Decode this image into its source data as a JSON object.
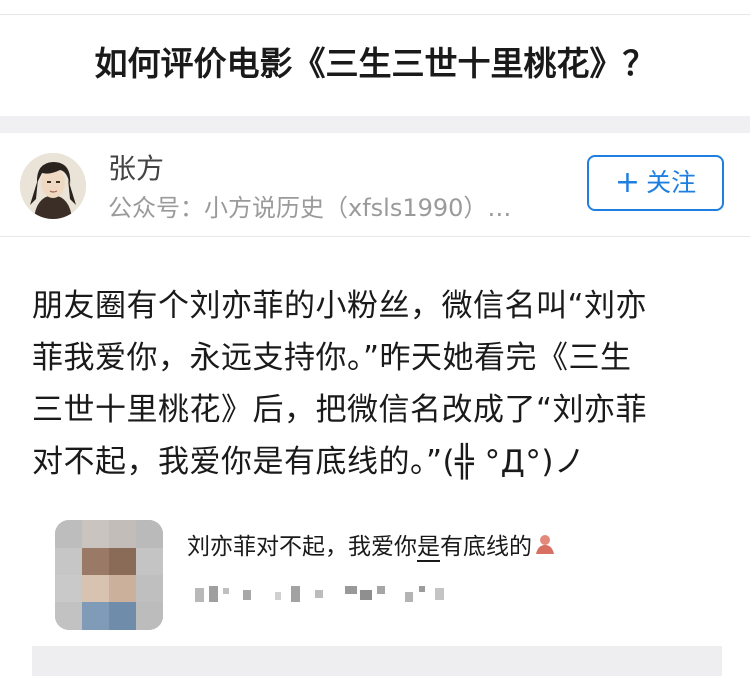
{
  "question": {
    "title": "如何评价电影《三生三世十里桃花》？"
  },
  "author": {
    "name": "张方",
    "bio": "公众号：小方说历史（xfsls1990）…",
    "avatar_icon": "portrait-avatar-icon"
  },
  "follow_button": {
    "icon": "plus-icon",
    "icon_glyph": "+",
    "label": "关注",
    "color": "#1f7fe0"
  },
  "answer": {
    "lines": [
      "朋友圈有个刘亦菲的小粉丝，微信名叫“刘亦",
      "菲我爱你，永远支持你。”昨天她看完《三生",
      "三世十里桃花》后，把微信名改成了“刘亦菲",
      "对不起，我爱你是有底线的。”(╬ °Д°)ノ"
    ]
  },
  "embedded_screenshot": {
    "name_before": "刘亦菲对不起，我爱你",
    "name_underlined": "是",
    "name_after": "有底线的",
    "emoji_icon": "person-emoji-icon"
  }
}
